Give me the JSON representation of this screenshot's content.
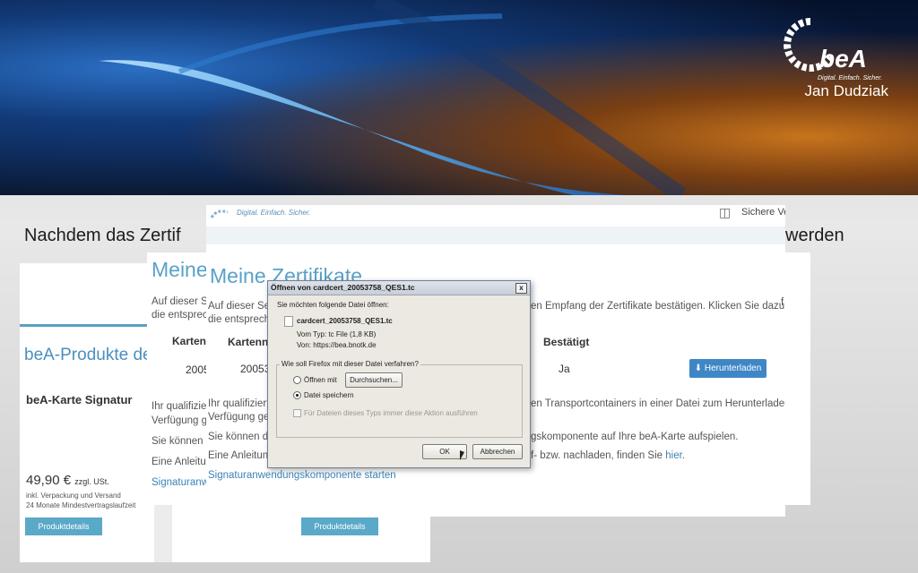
{
  "banner": {
    "logo_text": "beA",
    "logo_tagline": "Digital. Einfach. Sicher.",
    "author": "Jan Dudziak"
  },
  "caption": {
    "left": "Nachdem das Zertif",
    "right": "werden"
  },
  "product_card": {
    "heading": "beA-Produkte de",
    "name": "beA-Karte Signatur",
    "price": "49,90 €",
    "price_suffix": "zzgl. USt.",
    "note1": "inkl. Verpackung und Versand",
    "note2": "24 Monate Mindestvertragslaufzeit",
    "details_button": "Produktdetails",
    "details_button_2": "Produktdetails"
  },
  "mid_shot": {
    "title": "Meine",
    "line1": "Auf dieser S",
    "line2": "die entsprec",
    "col_header": "Kartenn",
    "cell": "2005",
    "para1": "Ihr qualifizie",
    "para1b": "Verfügung g",
    "para2": "Sie können",
    "para3": "Eine Anleitu",
    "link": "Signaturanw"
  },
  "front_shot": {
    "brand": "Digital. Einfach. Sicher.",
    "secure": "Sichere Ve",
    "title": "Meine Zertifikate",
    "line1_left": "Auf dieser Sei",
    "line1_right": "en Empfang der Zertifikate bestätigen. Klicken Sie dazu bitte",
    "line1_end": "f",
    "line2_left": "die entsprech",
    "col_kartennr": "Kartennu",
    "col_bestaetigt": "Bestätigt",
    "cell_kartennr": "20053",
    "cell_bestaetigt": "Ja",
    "download_button": "Herunterladen",
    "para1_left": "Ihr qualifiziert",
    "para1_right": "en Transportcontainers in einer Datei zum Herunterladen zu",
    "para1b": "Verfügung ges",
    "para2_left": "Sie können die",
    "para2_right": "gskomponente auf Ihre beA-Karte aufspielen.",
    "para3_left": "Eine Anleitung",
    "para3_right": "f- bzw. nachladen, finden Sie",
    "para3_link": "hier",
    "para3_end": ".",
    "start_link": "Signaturanwendungskomponente starten"
  },
  "dialog": {
    "title": "Öffnen von cardcert_20053758_QES1.tc",
    "close": "x",
    "intro": "Sie möchten folgende Datei öffnen:",
    "filename": "cardcert_20053758_QES1.tc",
    "type_line": "Vom Typ:  tc File (1,8 KB)",
    "from_line": "Von:  https://bea.bnotk.de",
    "question": "Wie soll Firefox mit dieser Datei verfahren?",
    "open_with": "Öffnen mit",
    "browse_button": "Durchsuchen...",
    "save_file": "Datei speichern",
    "always_checkbox": "Für Dateien dieses Typs immer diese Aktion ausführen",
    "ok_button": "OK",
    "cancel_button": "Abbrechen",
    "selected_option": "save"
  }
}
